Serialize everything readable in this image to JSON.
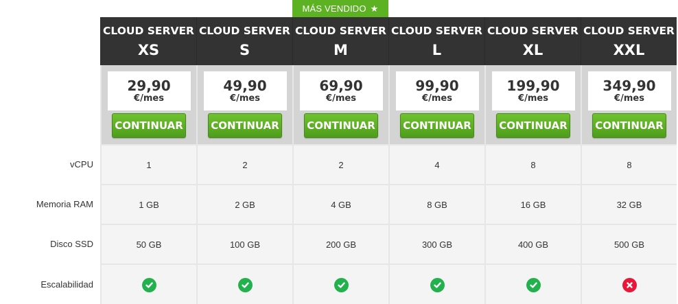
{
  "badge": {
    "label": "MÁS VENDIDO",
    "icon": "star-icon"
  },
  "plans": [
    {
      "line1": "CLOUD SERVER",
      "size": "XS",
      "price": "29,90",
      "period": "€/mes",
      "button": "CONTINUAR"
    },
    {
      "line1": "CLOUD SERVER",
      "size": "S",
      "price": "49,90",
      "period": "€/mes",
      "button": "CONTINUAR"
    },
    {
      "line1": "CLOUD SERVER",
      "size": "M",
      "price": "69,90",
      "period": "€/mes",
      "button": "CONTINUAR"
    },
    {
      "line1": "CLOUD SERVER",
      "size": "L",
      "price": "99,90",
      "period": "€/mes",
      "button": "CONTINUAR"
    },
    {
      "line1": "CLOUD SERVER",
      "size": "XL",
      "price": "199,90",
      "period": "€/mes",
      "button": "CONTINUAR"
    },
    {
      "line1": "CLOUD SERVER",
      "size": "XXL",
      "price": "349,90",
      "period": "€/mes",
      "button": "CONTINUAR"
    }
  ],
  "rows": [
    {
      "label": "vCPU",
      "values": [
        "1",
        "2",
        "2",
        "4",
        "8",
        "8"
      ]
    },
    {
      "label": "Memoria RAM",
      "values": [
        "1 GB",
        "2 GB",
        "4 GB",
        "8 GB",
        "16 GB",
        "32 GB"
      ]
    },
    {
      "label": "Disco SSD",
      "values": [
        "50 GB",
        "100 GB",
        "200 GB",
        "300 GB",
        "400 GB",
        "500 GB"
      ]
    }
  ],
  "scalability": {
    "label": "Escalabilidad",
    "values": [
      true,
      true,
      true,
      true,
      true,
      false
    ]
  },
  "colors": {
    "header_bg": "#333333",
    "accent_green": "#5db224",
    "check_green": "#22b14c",
    "cross_red": "#e8173a"
  }
}
